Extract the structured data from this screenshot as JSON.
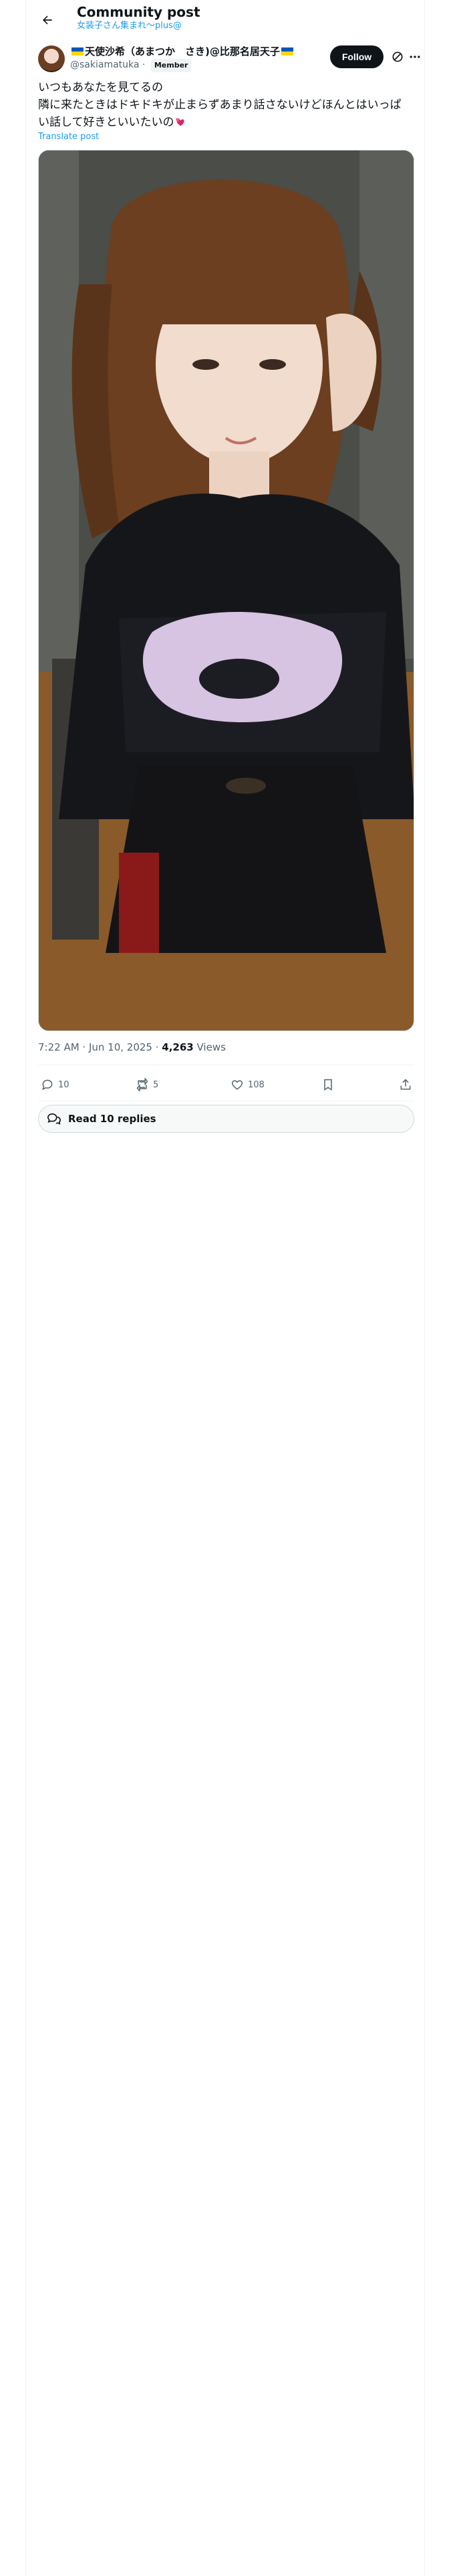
{
  "header": {
    "title": "Community post",
    "subtitle": "女装子さん集まれ〜plus@"
  },
  "author": {
    "display_name_main": "天使沙希（あまつか　さき)@比那名居天子",
    "handle": "@sakiamatuka",
    "separator": "·",
    "badge": "Member",
    "flag_colors": [
      "#0057b7",
      "#ffd700"
    ]
  },
  "actions_top": {
    "follow_label": "Follow"
  },
  "post": {
    "text": "いつもあなたを見てるの\n隣に来たときはドキドキが止まらずあまり話さないけどほんとはいっぱい話して好きといいたいの",
    "translate_label": "Translate post",
    "timestamp": "7:22 AM · Jun 10, 2025 · ",
    "views_count": "4,263",
    "views_label": " Views"
  },
  "metrics": {
    "replies": "10",
    "reposts": "5",
    "likes": "108"
  },
  "read_replies": {
    "label": "Read 10 replies"
  },
  "colors": {
    "accent": "#1d9bf0",
    "text": "#0f1419",
    "muted": "#536471",
    "border": "#eff3f4"
  }
}
